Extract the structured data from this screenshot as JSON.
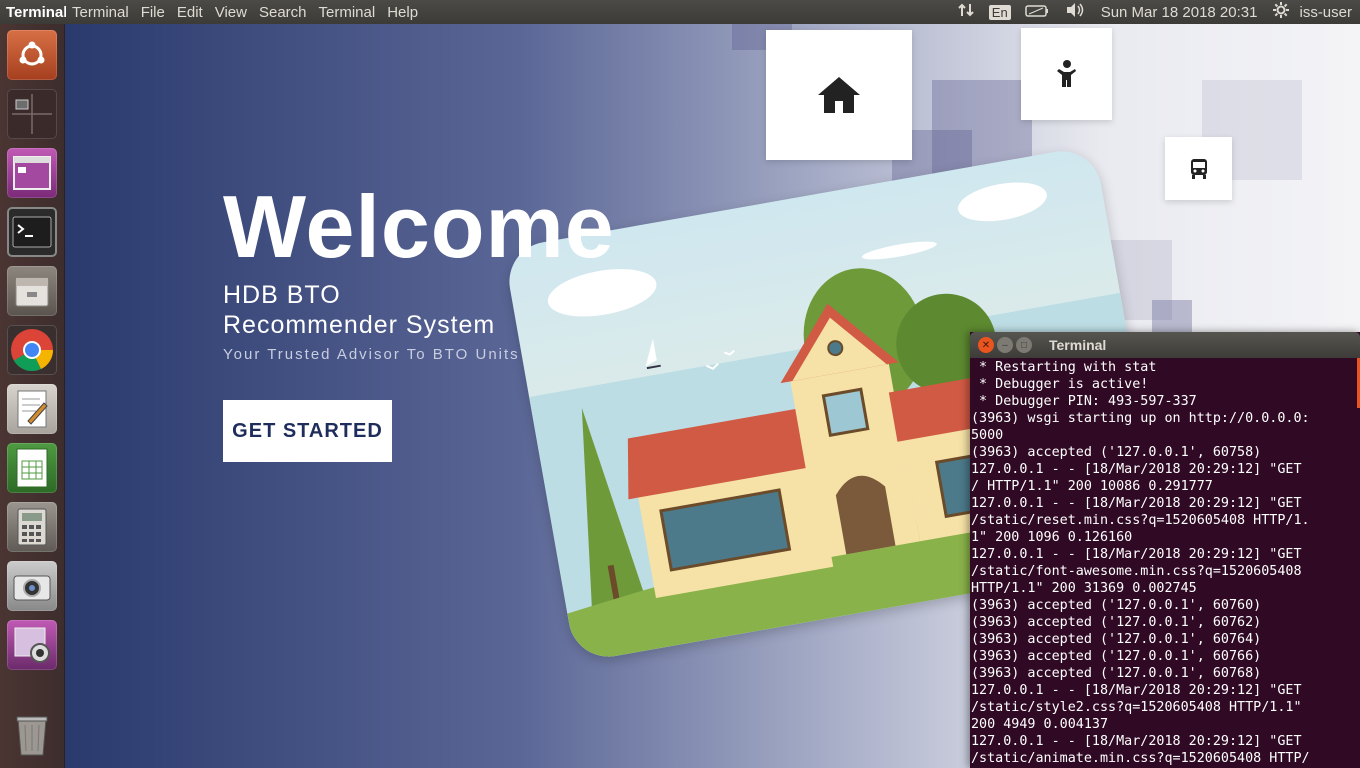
{
  "topbar": {
    "app_name": "Terminal",
    "menus": [
      "Terminal",
      "File",
      "Edit",
      "View",
      "Search",
      "Terminal",
      "Help"
    ],
    "keyboard": "En",
    "datetime": "Sun Mar 18 2018 20:31",
    "user": "iss-user",
    "icons": [
      "network-icon",
      "battery-icon",
      "volume-icon",
      "gear-icon"
    ]
  },
  "launcher": {
    "items": [
      "ubuntu-dash",
      "workspace-switcher",
      "app-window",
      "terminal",
      "file-manager",
      "chrome",
      "text-editor",
      "spreadsheet",
      "calculator",
      "camera",
      "photo-app",
      "trash"
    ]
  },
  "page": {
    "welcome": "Welcome",
    "subtitle": "HDB BTO Recommender System",
    "tagline": "Your Trusted Advisor To BTO Units",
    "cta": "GET STARTED"
  },
  "terminal": {
    "title": "Terminal",
    "lines": [
      " * Restarting with stat",
      " * Debugger is active!",
      " * Debugger PIN: 493-597-337",
      "(3963) wsgi starting up on http://0.0.0.0:",
      "5000",
      "(3963) accepted ('127.0.0.1', 60758)",
      "127.0.0.1 - - [18/Mar/2018 20:29:12] \"GET",
      "/ HTTP/1.1\" 200 10086 0.291777",
      "127.0.0.1 - - [18/Mar/2018 20:29:12] \"GET",
      "/static/reset.min.css?q=1520605408 HTTP/1.",
      "1\" 200 1096 0.126160",
      "127.0.0.1 - - [18/Mar/2018 20:29:12] \"GET",
      "/static/font-awesome.min.css?q=1520605408",
      "HTTP/1.1\" 200 31369 0.002745",
      "(3963) accepted ('127.0.0.1', 60760)",
      "(3963) accepted ('127.0.0.1', 60762)",
      "(3963) accepted ('127.0.0.1', 60764)",
      "(3963) accepted ('127.0.0.1', 60766)",
      "(3963) accepted ('127.0.0.1', 60768)",
      "127.0.0.1 - - [18/Mar/2018 20:29:12] \"GET",
      "/static/style2.css?q=1520605408 HTTP/1.1\"",
      "200 4949 0.004137",
      "127.0.0.1 - - [18/Mar/2018 20:29:12] \"GET",
      "/static/animate.min.css?q=1520605408 HTTP/"
    ]
  }
}
